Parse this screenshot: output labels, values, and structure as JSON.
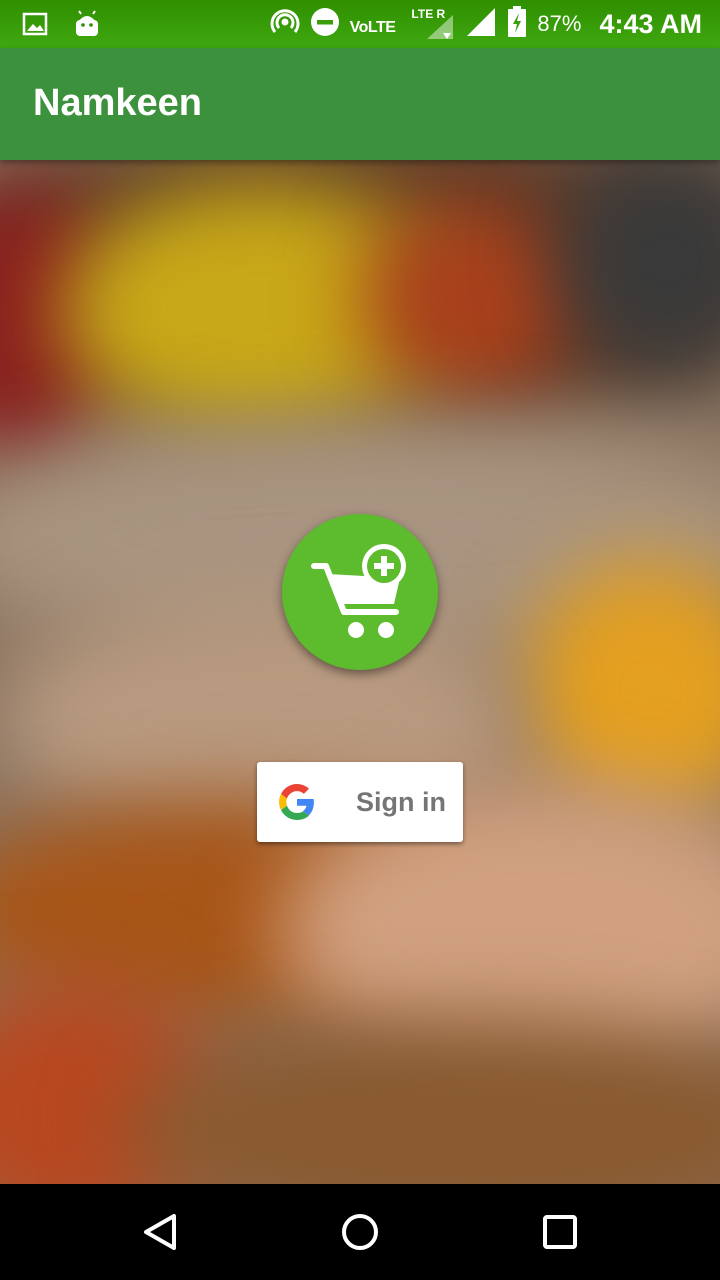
{
  "status_bar": {
    "network_label": "VoLTE",
    "lte_label": "LTE R",
    "battery_percent": "87%",
    "time": "4:43 AM",
    "icons": [
      "image-icon",
      "android-icon",
      "hotspot-icon",
      "do-not-disturb-icon",
      "signal-icon",
      "signal-icon",
      "battery-charging-icon"
    ]
  },
  "app_bar": {
    "title": "Namkeen",
    "color": "#3c923c"
  },
  "logo": {
    "icon": "cart-plus-icon",
    "color": "#5cbc2e"
  },
  "signin": {
    "label": "Sign in",
    "icon": "google-g-icon"
  },
  "nav_bar": {
    "icons": [
      "back-icon",
      "home-icon",
      "recents-icon"
    ]
  }
}
